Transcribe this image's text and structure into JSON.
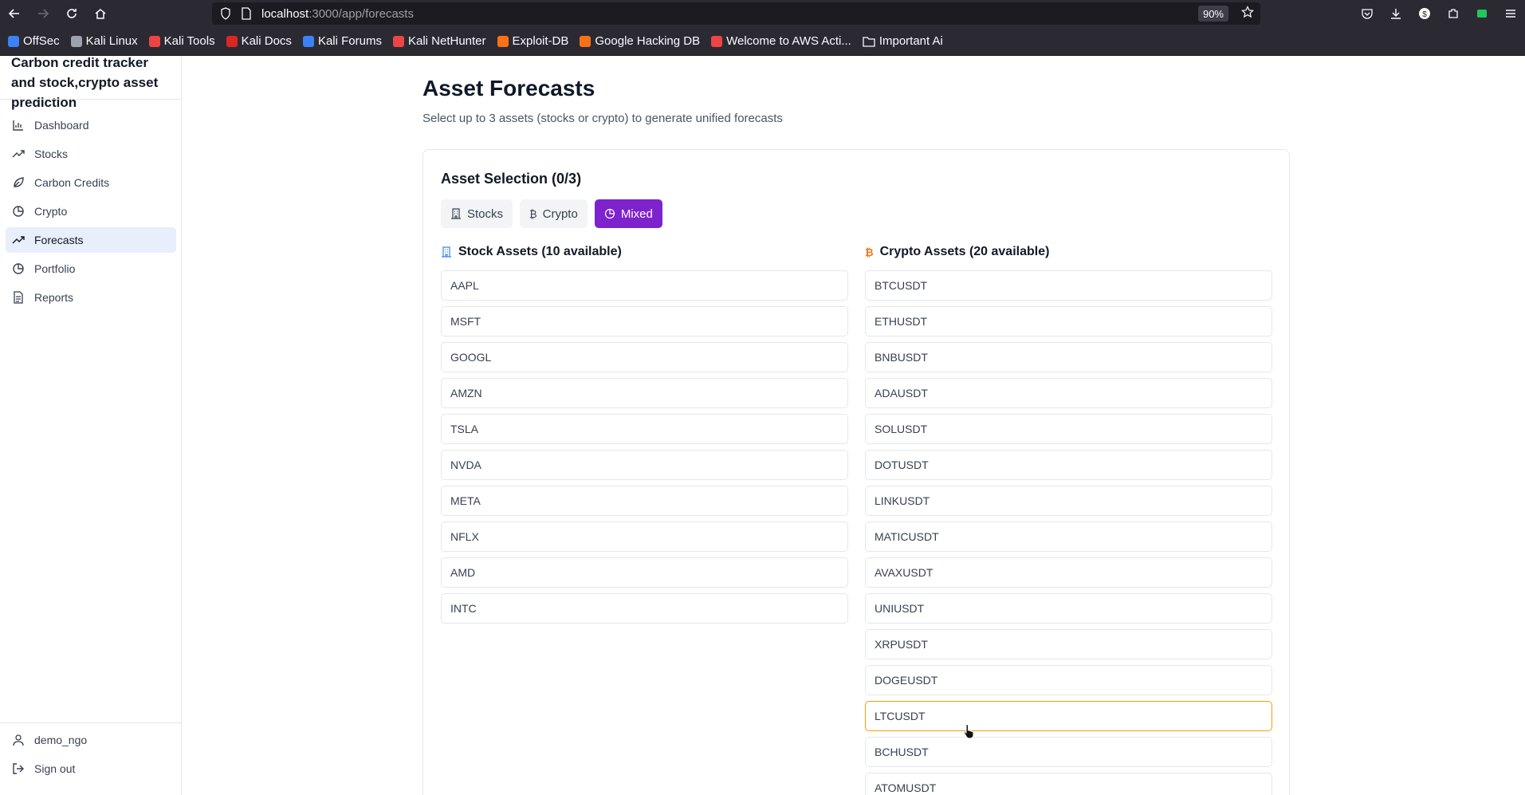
{
  "browser": {
    "url_host": "localhost",
    "url_path": ":3000/app/forecasts",
    "zoom": "90%",
    "bookmarks": [
      {
        "label": "OffSec",
        "color": "#3b82f6"
      },
      {
        "label": "Kali Linux",
        "color": "#9ca3af"
      },
      {
        "label": "Kali Tools",
        "color": "#ef4444"
      },
      {
        "label": "Kali Docs",
        "color": "#dc2626"
      },
      {
        "label": "Kali Forums",
        "color": "#3b82f6"
      },
      {
        "label": "Kali NetHunter",
        "color": "#ef4444"
      },
      {
        "label": "Exploit-DB",
        "color": "#f97316"
      },
      {
        "label": "Google Hacking DB",
        "color": "#f97316"
      },
      {
        "label": "Welcome to AWS Acti...",
        "color": "#ef4444"
      },
      {
        "label": "Important Ai",
        "color": "folder"
      }
    ]
  },
  "sidebar": {
    "brand": "Carbon credit tracker and stock,crypto asset prediction",
    "items": [
      {
        "label": "Dashboard",
        "icon": "bar-chart-icon"
      },
      {
        "label": "Stocks",
        "icon": "trending-up-icon"
      },
      {
        "label": "Carbon Credits",
        "icon": "leaf-icon"
      },
      {
        "label": "Crypto",
        "icon": "pie-chart-icon"
      },
      {
        "label": "Forecasts",
        "icon": "trending-up-icon"
      },
      {
        "label": "Portfolio",
        "icon": "pie-chart-icon"
      },
      {
        "label": "Reports",
        "icon": "file-text-icon"
      }
    ],
    "active": "Forecasts",
    "user": "demo_ngo",
    "signout": "Sign out"
  },
  "page": {
    "title": "Asset Forecasts",
    "subtitle": "Select up to 3 assets (stocks or crypto) to generate unified forecasts"
  },
  "selection": {
    "title": "Asset Selection (0/3)",
    "tabs": [
      "Stocks",
      "Crypto",
      "Mixed"
    ],
    "active_tab": "Mixed",
    "stock_header": "Stock Assets (10 available)",
    "crypto_header": "Crypto Assets (20 available)",
    "stocks": [
      "AAPL",
      "MSFT",
      "GOOGL",
      "AMZN",
      "TSLA",
      "NVDA",
      "META",
      "NFLX",
      "AMD",
      "INTC"
    ],
    "crypto": [
      "BTCUSDT",
      "ETHUSDT",
      "BNBUSDT",
      "ADAUSDT",
      "SOLUSDT",
      "DOTUSDT",
      "LINKUSDT",
      "MATICUSDT",
      "AVAXUSDT",
      "UNIUSDT",
      "XRPUSDT",
      "DOGEUSDT",
      "LTCUSDT",
      "BCHUSDT",
      "ATOMUSDT"
    ],
    "hovered": "LTCUSDT",
    "accent": "#7e22ce"
  }
}
